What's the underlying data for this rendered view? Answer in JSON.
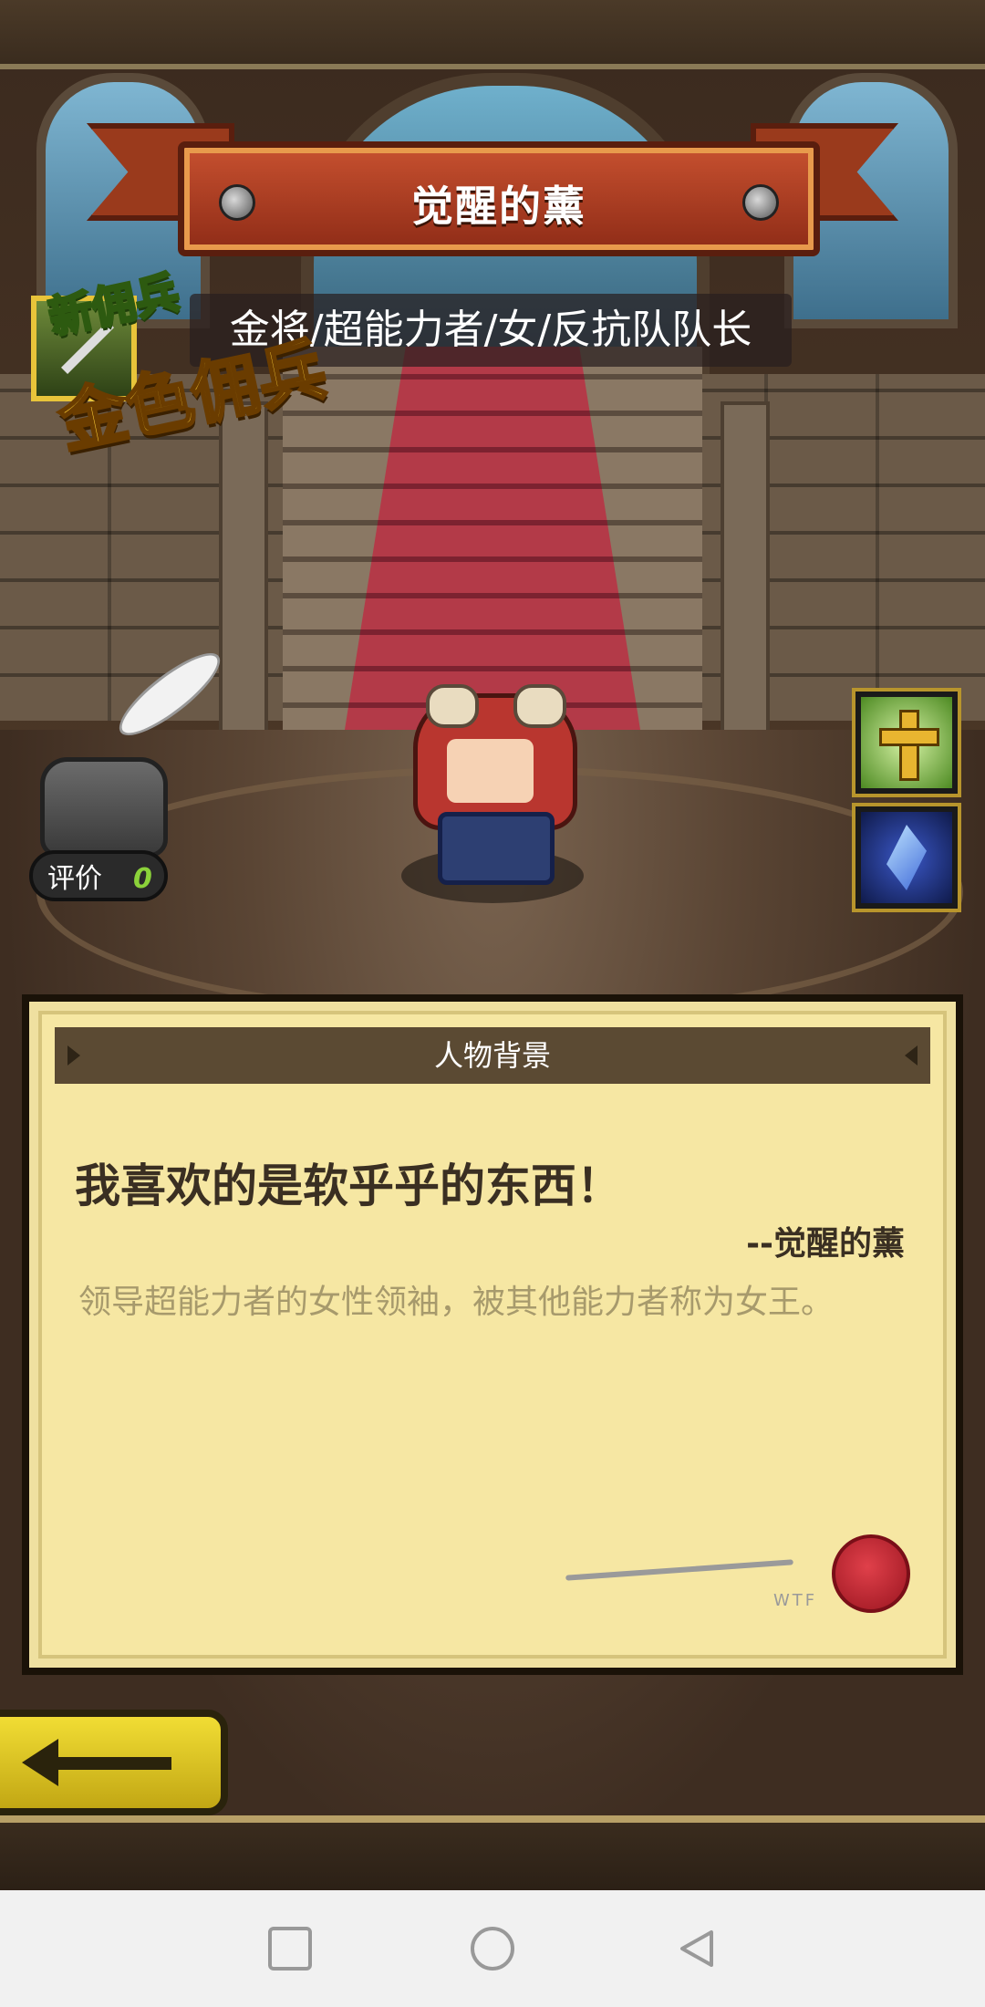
{
  "header": {
    "title": "觉醒的薰",
    "subtitle": "金将/超能力者/女/反抗队队长"
  },
  "badge": {
    "new_text": "新佣兵",
    "rank_text": "金色佣兵"
  },
  "rating": {
    "label": "评价",
    "value": "0"
  },
  "skills": [
    "cross-skill-icon",
    "crystal-skill-icon"
  ],
  "panel": {
    "header": "人物背景",
    "quote": "我喜欢的是软乎乎的东西！",
    "quote_author": "--觉醒的薰",
    "description": "领导超能力者的女性领袖，被其他能力者称为女王。",
    "signature_mark": "WTF"
  },
  "colors": {
    "panel_bg": "#f6e7a3",
    "panel_header": "#5b4a33",
    "gold_text": "#ffd23a",
    "back_button": "#f1dd34"
  },
  "navbar": {
    "icons": [
      "recent-apps-icon",
      "home-icon",
      "back-icon"
    ]
  }
}
